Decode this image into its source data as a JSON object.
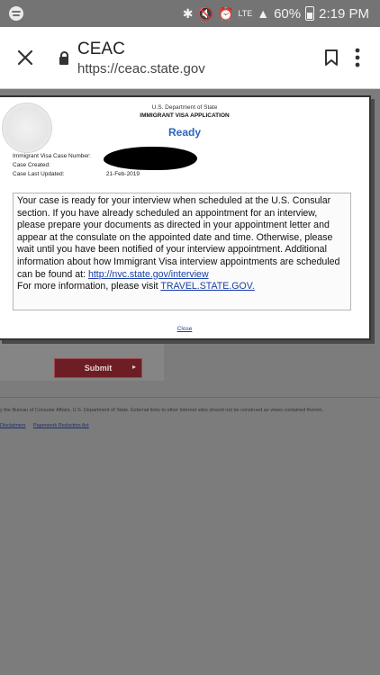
{
  "status_bar": {
    "battery": "60%",
    "time": "2:19 PM",
    "signal_label": "LTE"
  },
  "browser": {
    "site_title": "CEAC",
    "url": "https://ceac.state.gov"
  },
  "modal": {
    "dept": "U.S. Department of State",
    "app_title": "IMMIGRANT VISA APPLICATION",
    "status": "Ready",
    "rows": [
      {
        "label": "Immigrant Visa Case Number:",
        "value": ""
      },
      {
        "label": "Case Created:",
        "value": ""
      },
      {
        "label": "Case Last Updated:",
        "value": "21-Feb-2019"
      }
    ],
    "message": "Your case is ready for your interview when scheduled at the U.S. Consular section. If you have already scheduled an appointment for an interview, please prepare your documents as directed in your appointment letter and appear at the consulate on the appointed date and time. Otherwise, please wait until you have been notified of your interview appointment. Additional information about how Immigrant Visa interview appointments are scheduled can be found at: ",
    "interview_link": "http://nvc.state.gov/interview",
    "more_info": "For more information, please visit ",
    "travel_link": "TRAVEL.STATE.GOV.",
    "close_label": "Close"
  },
  "background": {
    "submit_label": "Submit",
    "footer_text": "y the Bureau of Consular Affairs, U.S. Department of State. External links to other Internet sites should not be construed as views contained therein.",
    "footer_links": [
      "Disclaimers",
      "Paperwork Reduction Act"
    ]
  },
  "colors": {
    "accent_blue": "#2a67b8",
    "submit_red": "#6d1d24"
  }
}
